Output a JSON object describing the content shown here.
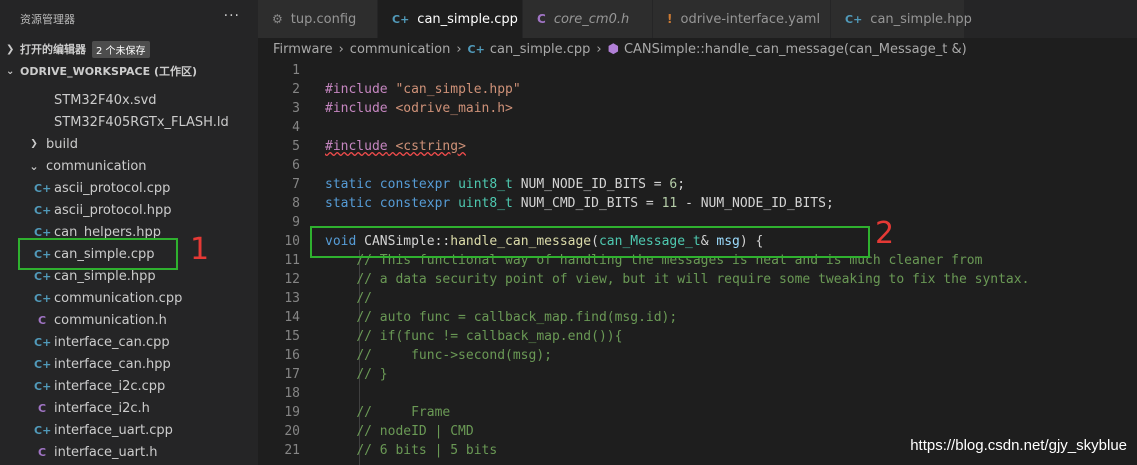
{
  "sidebar": {
    "title": "资源管理器",
    "more": "···",
    "open_editors": {
      "label": "打开的编辑器",
      "badge": "2 个未保存"
    },
    "workspace": {
      "label": "ODRIVE_WORKSPACE (工作区)"
    },
    "tree": [
      {
        "label": "STM32F40x.svd",
        "icon": "none"
      },
      {
        "label": "STM32F405RGTx_FLASH.ld",
        "icon": "none"
      },
      {
        "label": "build",
        "icon": "folder-collapsed"
      },
      {
        "label": "communication",
        "icon": "folder-expanded"
      },
      {
        "label": "ascii_protocol.cpp",
        "icon": "cpp"
      },
      {
        "label": "ascii_protocol.hpp",
        "icon": "cpp"
      },
      {
        "label": "can_helpers.hpp",
        "icon": "cpp"
      },
      {
        "label": "can_simple.cpp",
        "icon": "cpp"
      },
      {
        "label": "can_simple.hpp",
        "icon": "cpp"
      },
      {
        "label": "communication.cpp",
        "icon": "cpp"
      },
      {
        "label": "communication.h",
        "icon": "c"
      },
      {
        "label": "interface_can.cpp",
        "icon": "cpp"
      },
      {
        "label": "interface_can.hpp",
        "icon": "cpp"
      },
      {
        "label": "interface_i2c.cpp",
        "icon": "cpp"
      },
      {
        "label": "interface_i2c.h",
        "icon": "c"
      },
      {
        "label": "interface_uart.cpp",
        "icon": "cpp"
      },
      {
        "label": "interface_uart.h",
        "icon": "c"
      }
    ]
  },
  "tabs": [
    {
      "label": "tup.config",
      "icon": "gear",
      "active": false,
      "dirty": false
    },
    {
      "label": "can_simple.cpp",
      "icon": "cpp",
      "active": true,
      "dirty": true
    },
    {
      "label": "core_cm0.h",
      "icon": "c",
      "active": false,
      "dirty": false
    },
    {
      "label": "odrive-interface.yaml",
      "icon": "yaml",
      "active": false,
      "dirty": true
    },
    {
      "label": "can_simple.hpp",
      "icon": "cpp",
      "active": false,
      "dirty": false
    }
  ],
  "breadcrumb": {
    "parts": [
      "Firmware",
      "communication",
      "can_simple.cpp",
      "CANSimple::handle_can_message(can_Message_t &)"
    ]
  },
  "code_lines": [
    {
      "n": "1",
      "t": ""
    },
    {
      "n": "2",
      "t": "#include \"can_simple.hpp\""
    },
    {
      "n": "3",
      "t": "#include <odrive_main.h>"
    },
    {
      "n": "4",
      "t": ""
    },
    {
      "n": "5",
      "t": "#include <cstring>"
    },
    {
      "n": "6",
      "t": ""
    },
    {
      "n": "7",
      "t": "static constexpr uint8_t NUM_NODE_ID_BITS = 6;"
    },
    {
      "n": "8",
      "t": "static constexpr uint8_t NUM_CMD_ID_BITS = 11 - NUM_NODE_ID_BITS;"
    },
    {
      "n": "9",
      "t": ""
    },
    {
      "n": "10",
      "t": "void CANSimple::handle_can_message(can_Message_t& msg) {"
    },
    {
      "n": "11",
      "t": "    // This functional way of handling the messages is neat and is much cleaner from"
    },
    {
      "n": "12",
      "t": "    // a data security point of view, but it will require some tweaking to fix the syntax."
    },
    {
      "n": "13",
      "t": "    //"
    },
    {
      "n": "14",
      "t": "    // auto func = callback_map.find(msg.id);"
    },
    {
      "n": "15",
      "t": "    // if(func != callback_map.end()){"
    },
    {
      "n": "16",
      "t": "    //     func->second(msg);"
    },
    {
      "n": "17",
      "t": "    // }"
    },
    {
      "n": "18",
      "t": ""
    },
    {
      "n": "19",
      "t": "    //     Frame"
    },
    {
      "n": "20",
      "t": "    // nodeID | CMD"
    },
    {
      "n": "21",
      "t": "    // 6 bits | 5 bits"
    }
  ],
  "annotations": {
    "marker1": "1",
    "marker2": "2"
  },
  "watermark": "https://blog.csdn.net/gjy_skyblue"
}
